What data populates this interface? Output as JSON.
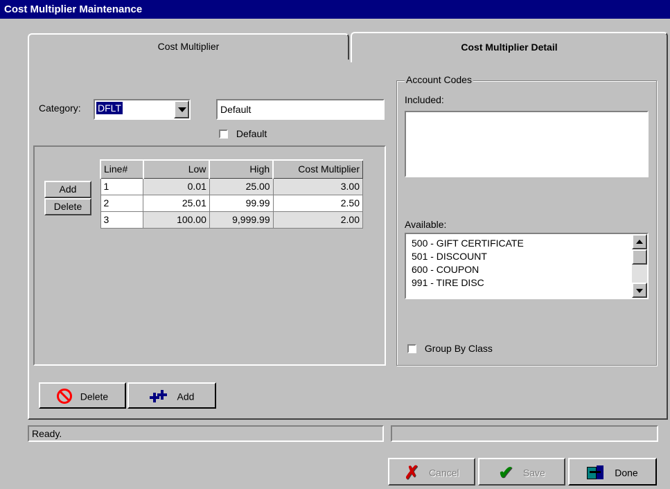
{
  "window": {
    "title": "Cost Multiplier Maintenance"
  },
  "tabs": [
    {
      "label": "Cost Multiplier",
      "active": false
    },
    {
      "label": "Cost Multiplier Detail",
      "active": true
    }
  ],
  "category": {
    "label": "Category:",
    "code": "DFLT",
    "description": "Default",
    "default_checkbox_label": "Default",
    "default_checked": false
  },
  "grid": {
    "add_label": "Add",
    "delete_label": "Delete",
    "columns": [
      "Line#",
      "Low",
      "High",
      "Cost Multiplier"
    ],
    "rows": [
      [
        "1",
        "0.01",
        "25.00",
        "3.00"
      ],
      [
        "2",
        "25.01",
        "99.99",
        "2.50"
      ],
      [
        "3",
        "100.00",
        "9,999.99",
        "2.00"
      ]
    ]
  },
  "account_codes": {
    "group_label": "Account Codes",
    "included_label": "Included:",
    "available_label": "Available:",
    "available_items": [
      "500 - GIFT CERTIFICATE",
      "501 - DISCOUNT",
      "600 - COUPON",
      "991 - TIRE DISC"
    ],
    "group_by_class_label": "Group By Class",
    "group_by_class_checked": false
  },
  "bottom_buttons": {
    "delete_label": "Delete",
    "add_label": "Add"
  },
  "status": {
    "text": "Ready.",
    "secondary": ""
  },
  "dialog_buttons": {
    "cancel_label": "Cancel",
    "save_label": "Save",
    "done_label": "Done"
  },
  "colors": {
    "titlebar": "#000080",
    "selection": "#000080",
    "face": "#c0c0c0",
    "delete_icon": "#ff0000",
    "add_icon": "#000080",
    "cancel_icon": "#cc0000",
    "save_icon": "#008000"
  }
}
